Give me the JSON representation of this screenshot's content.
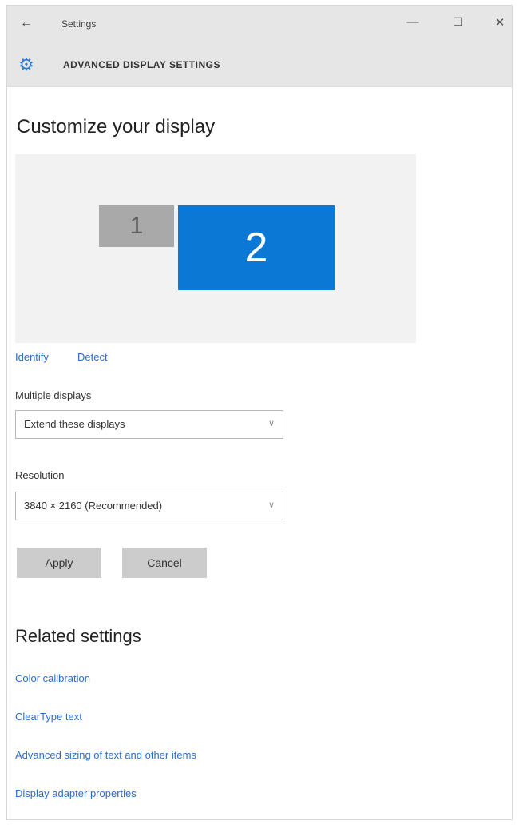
{
  "window": {
    "title": "Settings",
    "back_icon": "back-arrow-icon",
    "minimize": "—",
    "maximize": "☐",
    "close": "✕"
  },
  "page": {
    "header": "ADVANCED DISPLAY SETTINGS",
    "header_icon": "gear-icon",
    "title": "Customize your display"
  },
  "preview": {
    "display1": "1",
    "display2": "2",
    "display2_color": "#0b78d6"
  },
  "links": {
    "identify": "Identify",
    "detect": "Detect"
  },
  "multiple_displays": {
    "label": "Multiple displays",
    "value": "Extend these displays"
  },
  "resolution": {
    "label": "Resolution",
    "value": "3840 × 2160 (Recommended)"
  },
  "buttons": {
    "apply": "Apply",
    "cancel": "Cancel"
  },
  "related": {
    "title": "Related settings",
    "items": [
      "Color calibration",
      "ClearType text",
      "Advanced sizing of text and other items",
      "Display adapter properties"
    ]
  },
  "colors": {
    "accent": "#2a6fc7",
    "titlebar_bg": "#e6e6e6",
    "button_bg": "#cccccc"
  }
}
